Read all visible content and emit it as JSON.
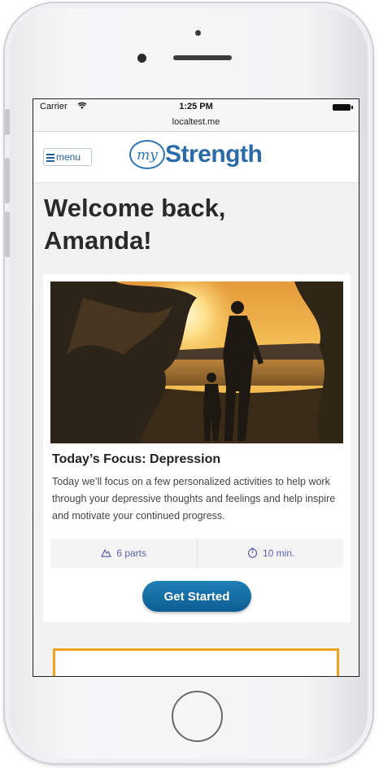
{
  "status_bar": {
    "carrier": "Carrier",
    "time": "1:25 PM"
  },
  "browser": {
    "url": "localtest.me"
  },
  "header": {
    "menu_label": "menu",
    "logo_my": "my",
    "logo_strength": "Strength"
  },
  "welcome": {
    "line1": "Welcome back,",
    "line2": "Amanda!"
  },
  "focus_card": {
    "title": "Today’s Focus: Depression",
    "description": "Today we’ll focus on a few personalized activities to help work through your depressive thoughts and feelings and help inspire and motivate your continued progress.",
    "parts": "6 parts",
    "duration": "10 min.",
    "cta_label": "Get Started"
  },
  "next_card": {
    "partial_text": ""
  },
  "icons": {
    "wifi": "wifi-icon",
    "battery": "battery-icon",
    "menu": "hamburger-icon",
    "parts": "mountain-icon",
    "duration": "timer-icon"
  },
  "colors": {
    "brand_blue": "#2a6aa8",
    "button_blue": "#0d5e92",
    "accent_orange": "#f0a21b",
    "stat_purple": "#5d62a8"
  }
}
